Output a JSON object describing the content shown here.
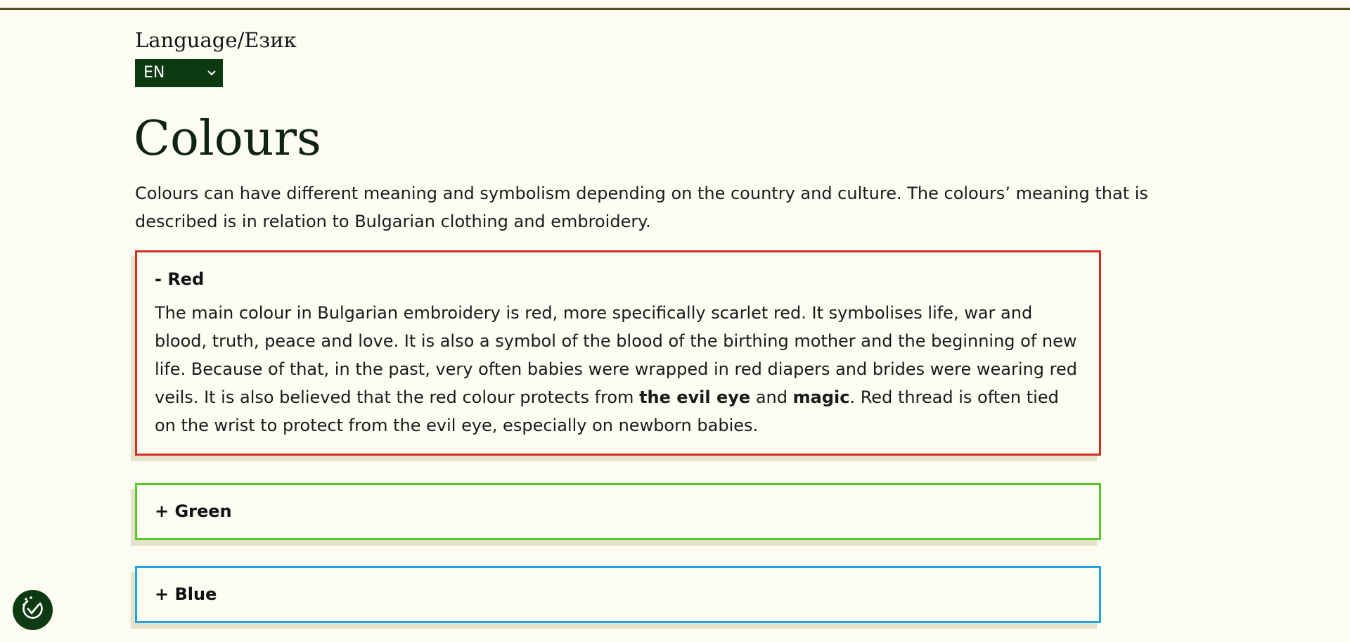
{
  "language": {
    "label": "Language/Език",
    "selected": "EN",
    "chevron_icon": "chevron-down-icon"
  },
  "page": {
    "title": "Colours",
    "intro": "Colours can have different meaning and symbolism depending on the country and culture. The colours’ meaning that is described is in relation to Bulgarian clothing and embroidery."
  },
  "panels": [
    {
      "header": "- Red",
      "expanded": true,
      "border_color": "#d32b22",
      "body": {
        "part1": "The main colour in Bulgarian embroidery is red, more specifically scarlet red. It symbolises life, war and blood, truth, peace and love. It is also a symbol of the blood of the birthing mother and the beginning of new life. Because of that, in the past, very often babies were wrapped in red diapers and brides were wearing red veils. It is also believed that the red colour protects from ",
        "bold1": "the evil eye",
        "part2": " and ",
        "bold2": "magic",
        "part3": ". Red thread is often tied on the wrist to protect from the evil eye, especially on newborn babies."
      }
    },
    {
      "header": "+ Green",
      "expanded": false,
      "border_color": "#57c827"
    },
    {
      "header": "+ Blue",
      "expanded": false,
      "border_color": "#1ea6e4"
    }
  ],
  "accessibility": {
    "icon": "accessibility-check-icon",
    "color": "#0e3a12"
  },
  "colors": {
    "background": "#fcfcf3",
    "accent_dark_green": "#0e3a12",
    "top_rule": "#5a4a1c"
  }
}
